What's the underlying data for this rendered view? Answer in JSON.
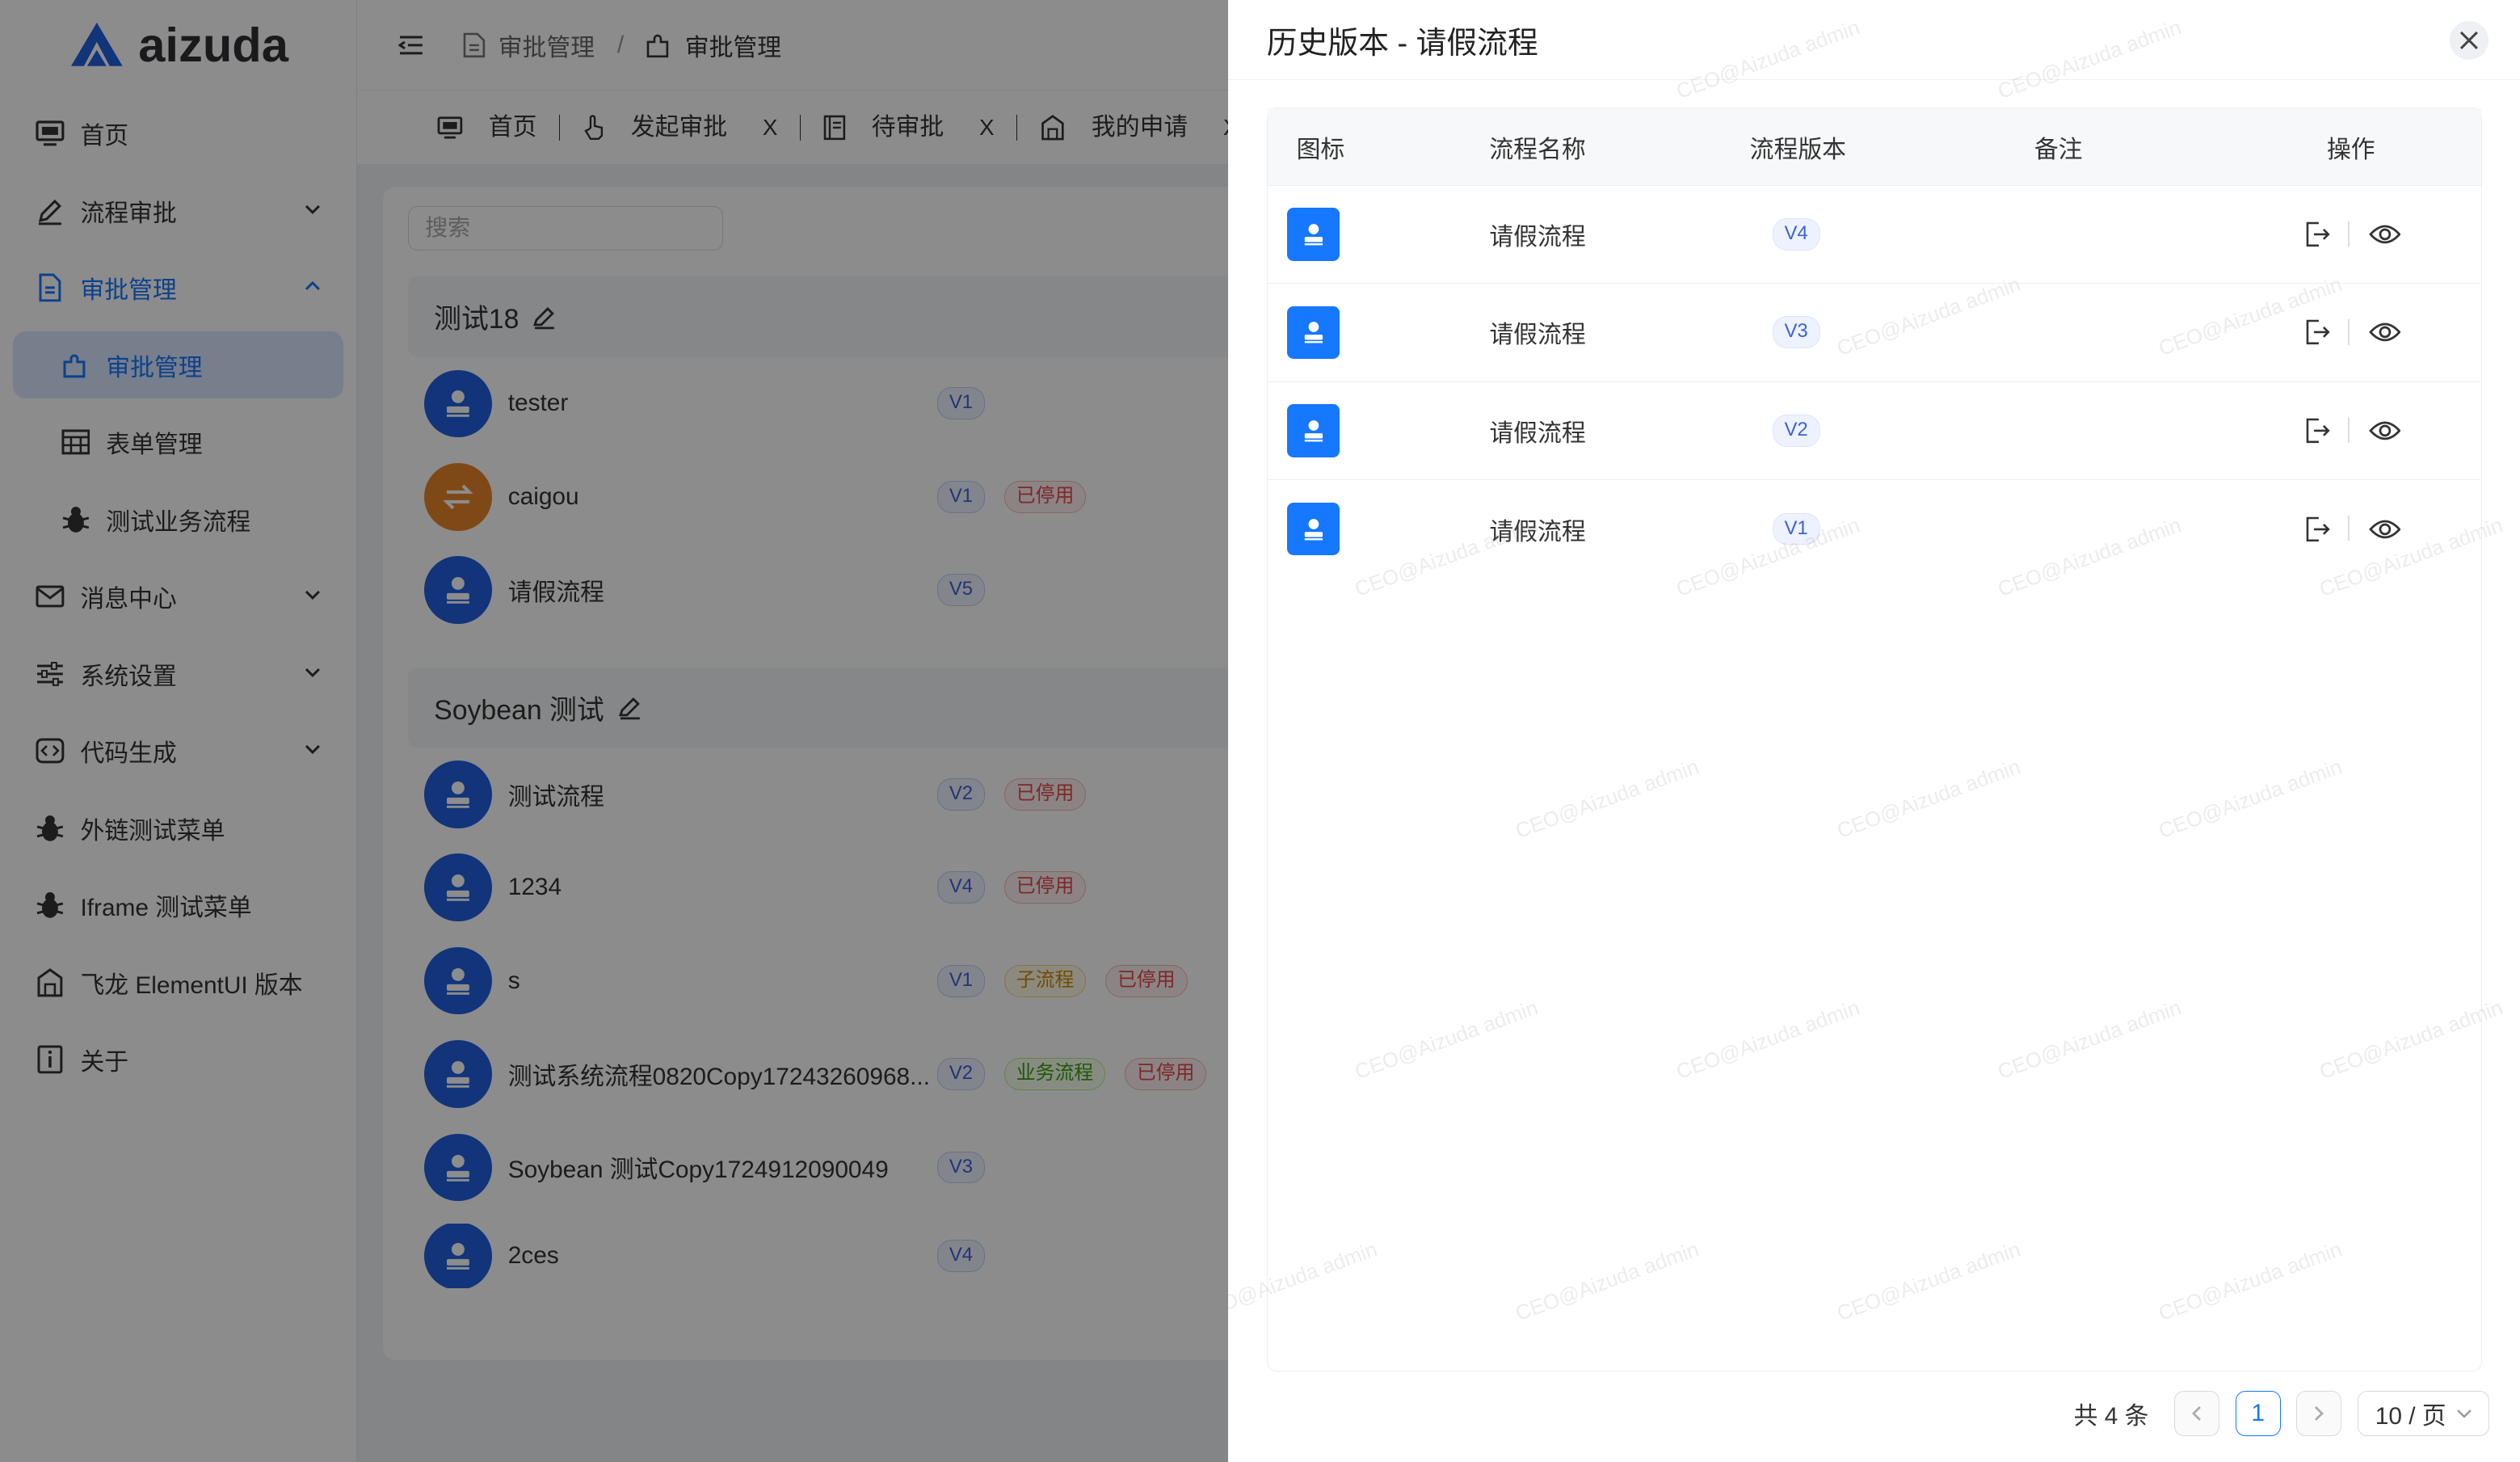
{
  "brand": {
    "name": "aizuda"
  },
  "sidebar": {
    "items": [
      {
        "label": "首页",
        "icon": "dashboard-icon"
      },
      {
        "label": "流程审批",
        "icon": "edit-icon"
      },
      {
        "label": "审批管理",
        "icon": "document-icon"
      },
      {
        "label": "审批管理",
        "icon": "puzzle-icon"
      },
      {
        "label": "表单管理",
        "icon": "table-icon"
      },
      {
        "label": "测试业务流程",
        "icon": "bug-icon"
      },
      {
        "label": "消息中心",
        "icon": "mail-icon"
      },
      {
        "label": "系统设置",
        "icon": "sliders-icon"
      },
      {
        "label": "代码生成",
        "icon": "code-icon"
      },
      {
        "label": "外链测试菜单",
        "icon": "bug-icon"
      },
      {
        "label": "Iframe 测试菜单",
        "icon": "bug-icon"
      },
      {
        "label": "飞龙 ElementUI 版本",
        "icon": "building-icon"
      },
      {
        "label": "关于",
        "icon": "info-icon"
      }
    ]
  },
  "header": {
    "breadcrumb": [
      "审批管理",
      "审批管理"
    ],
    "breadcrumb_sep": "/"
  },
  "tabs": [
    {
      "label": "首页"
    },
    {
      "label": "发起审批",
      "close": "X"
    },
    {
      "label": "待审批",
      "close": "X"
    },
    {
      "label": "我的申请",
      "close": "X"
    }
  ],
  "main": {
    "search_placeholder": "搜索",
    "groups": [
      {
        "title": "测试18",
        "rows": [
          {
            "name": "tester",
            "version": "V1",
            "tags": []
          },
          {
            "name": "caigou",
            "version": "V1",
            "tags": [
              "已停用"
            ]
          },
          {
            "name": "请假流程",
            "version": "V5",
            "tags": []
          }
        ]
      },
      {
        "title": "Soybean 测试",
        "rows": [
          {
            "name": "测试流程",
            "version": "V2",
            "tags": [
              "已停用"
            ]
          },
          {
            "name": "1234",
            "version": "V4",
            "tags": [
              "已停用"
            ]
          },
          {
            "name": "s",
            "version": "V1",
            "tags": [
              "子流程",
              "已停用"
            ]
          },
          {
            "name": "测试系统流程0820Copy17243260968...",
            "version": "V2",
            "tags": [
              "业务流程",
              "已停用"
            ]
          },
          {
            "name": "Soybean 测试Copy1724912090049",
            "version": "V3",
            "tags": []
          },
          {
            "name": "2ces",
            "version": "V4",
            "tags": []
          }
        ]
      }
    ]
  },
  "drawer": {
    "title": "历史版本 - 请假流程",
    "columns": [
      "图标",
      "流程名称",
      "流程版本",
      "备注",
      "操作"
    ],
    "rows": [
      {
        "name": "请假流程",
        "version": "V4",
        "note": ""
      },
      {
        "name": "请假流程",
        "version": "V3",
        "note": ""
      },
      {
        "name": "请假流程",
        "version": "V2",
        "note": ""
      },
      {
        "name": "请假流程",
        "version": "V1",
        "note": ""
      }
    ],
    "pagination": {
      "total": "共 4 条",
      "current": "1",
      "page_size": "10 / 页"
    }
  },
  "watermark": "CEO@Aizuda admin",
  "colors": {
    "accent": "#1677ff",
    "avatar_blue": "#1f5fe0",
    "avatar_orange": "#e8852b",
    "danger": "#e84749"
  }
}
